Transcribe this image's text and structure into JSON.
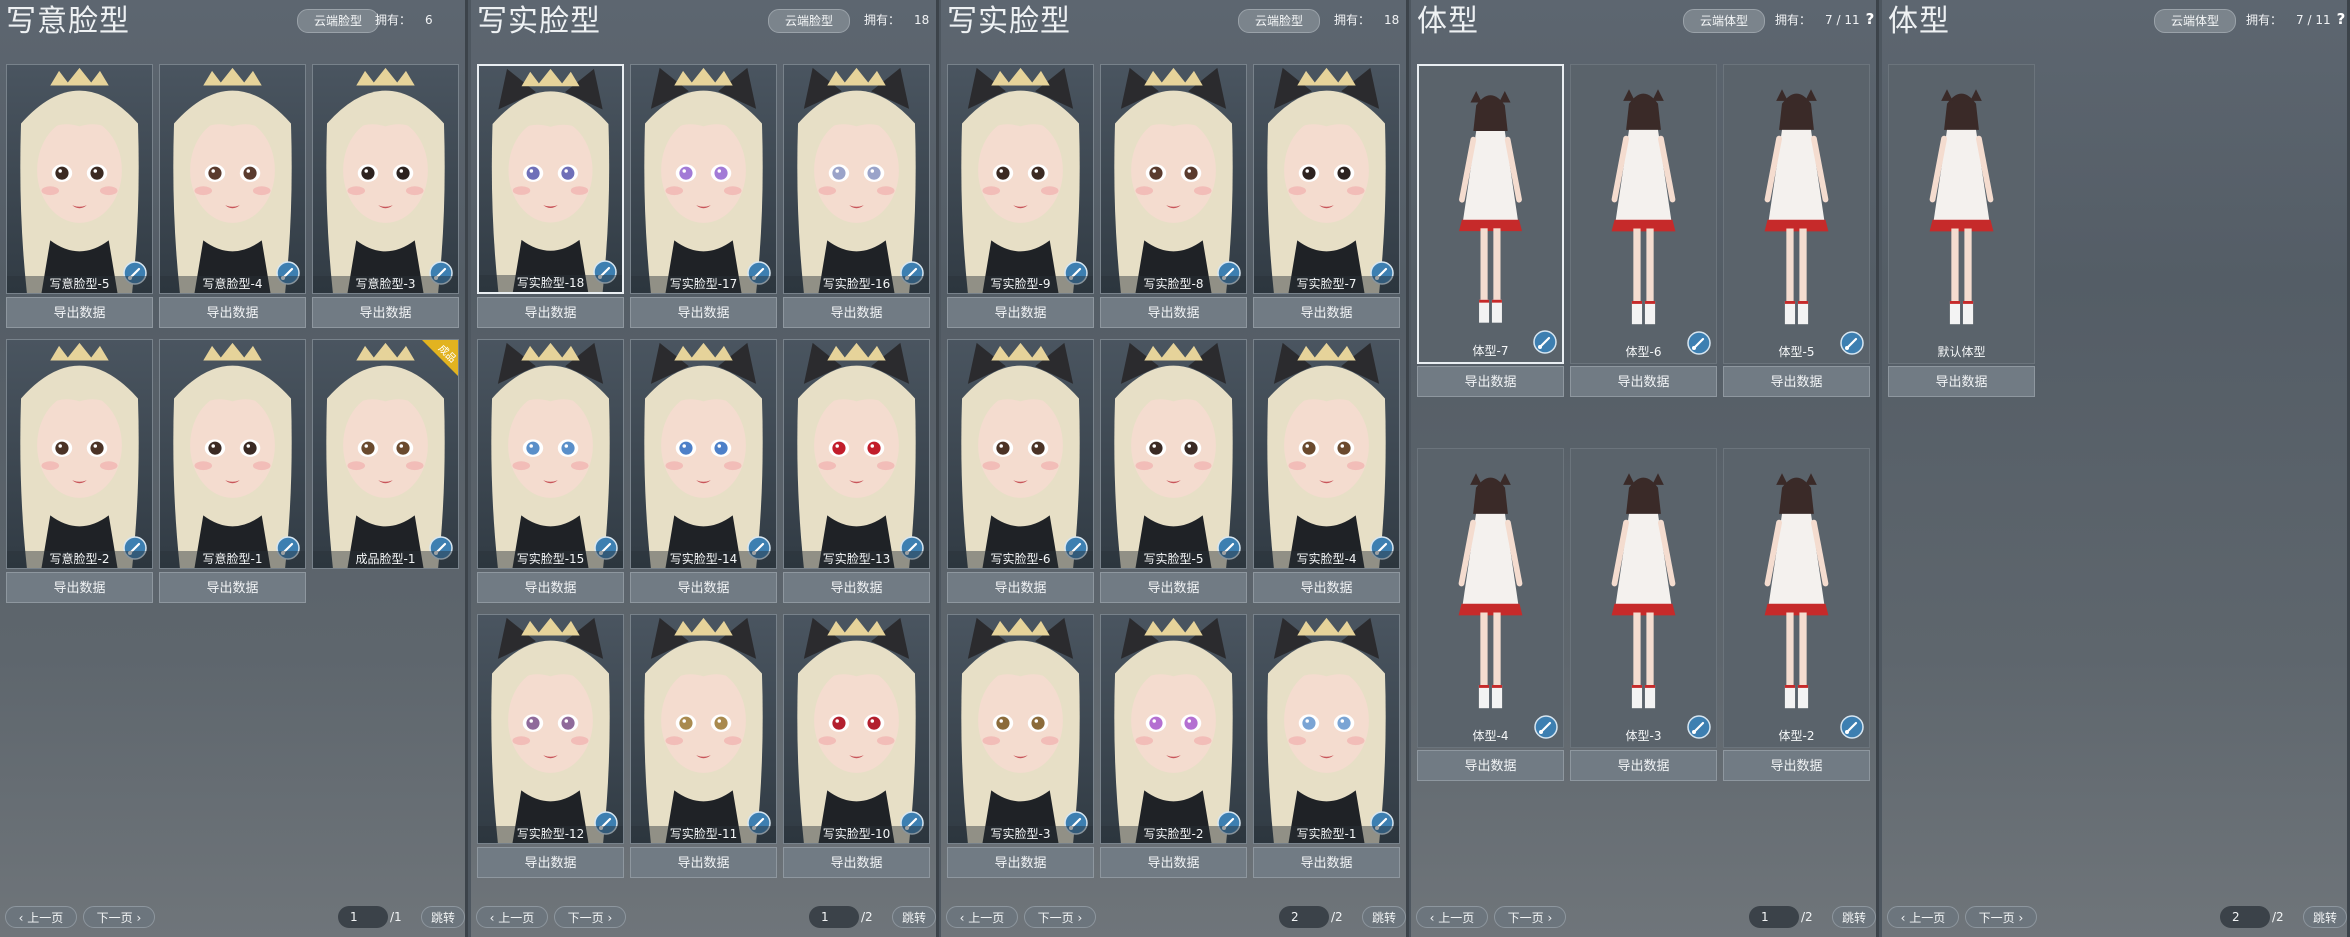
{
  "panels": [
    {
      "title": "写意脸型",
      "cloud_label": "云端脸型",
      "owned_label": "拥有：",
      "owned_value": "6",
      "cards": [
        {
          "label": "写意脸型-5"
        },
        {
          "label": "写意脸型-4"
        },
        {
          "label": "写意脸型-3"
        },
        {
          "label": "写意脸型-2"
        },
        {
          "label": "写意脸型-1"
        },
        {
          "label": "成品脸型-1",
          "ribbon": "成品"
        }
      ],
      "export_label": "导出数据",
      "pager": {
        "prev": "上一页",
        "next": "下一页",
        "page": "1",
        "total": "/1",
        "jump": "跳转"
      }
    },
    {
      "title": "写实脸型",
      "cloud_label": "云端脸型",
      "owned_label": "拥有：",
      "owned_value": "18",
      "cards": [
        {
          "label": "写实脸型-18"
        },
        {
          "label": "写实脸型-17"
        },
        {
          "label": "写实脸型-16"
        },
        {
          "label": "写实脸型-15"
        },
        {
          "label": "写实脸型-14"
        },
        {
          "label": "写实脸型-13"
        },
        {
          "label": "写实脸型-12"
        },
        {
          "label": "写实脸型-11"
        },
        {
          "label": "写实脸型-10"
        }
      ],
      "export_label": "导出数据",
      "pager": {
        "prev": "上一页",
        "next": "下一页",
        "page": "1",
        "total": "/2",
        "jump": "跳转"
      }
    },
    {
      "title": "写实脸型",
      "cloud_label": "云端脸型",
      "owned_label": "拥有：",
      "owned_value": "18",
      "cards": [
        {
          "label": "写实脸型-9"
        },
        {
          "label": "写实脸型-8"
        },
        {
          "label": "写实脸型-7"
        },
        {
          "label": "写实脸型-6"
        },
        {
          "label": "写实脸型-5"
        },
        {
          "label": "写实脸型-4"
        },
        {
          "label": "写实脸型-3"
        },
        {
          "label": "写实脸型-2"
        },
        {
          "label": "写实脸型-1"
        }
      ],
      "export_label": "导出数据",
      "pager": {
        "prev": "上一页",
        "next": "下一页",
        "page": "2",
        "total": "/2",
        "jump": "跳转"
      }
    },
    {
      "title": "体型",
      "cloud_label": "云端体型",
      "owned_label": "拥有：",
      "owned_value": "7 / 11",
      "help_icon": "?",
      "cards": [
        {
          "label": "体型-7"
        },
        {
          "label": "体型-6"
        },
        {
          "label": "体型-5"
        },
        {
          "label": "体型-4"
        },
        {
          "label": "体型-3"
        },
        {
          "label": "体型-2"
        }
      ],
      "export_label": "导出数据",
      "pager": {
        "prev": "上一页",
        "next": "下一页",
        "page": "1",
        "total": "/2",
        "jump": "跳转"
      }
    },
    {
      "title": "体型",
      "cloud_label": "云端体型",
      "owned_label": "拥有：",
      "owned_value": "7 / 11",
      "help_icon": "?",
      "cards": [
        {
          "label": "默认体型"
        }
      ],
      "export_label": "导出数据",
      "pager": {
        "prev": "上一页",
        "next": "下一页",
        "page": "2",
        "total": "/2",
        "jump": "跳转"
      }
    }
  ],
  "colors": {
    "hair": "#e7dfc6",
    "skin": "#f4dccf",
    "dress": "#f4f1ee",
    "accent_red": "#c62a2a",
    "badge": "#3d7fb1",
    "ribbon": "#e2b320",
    "cat_ear": "#2b2b2e"
  },
  "icons": {
    "badge": "brush-badge-icon",
    "nav_prev": "chevron-left-icon",
    "nav_next": "chevron-right-icon"
  }
}
